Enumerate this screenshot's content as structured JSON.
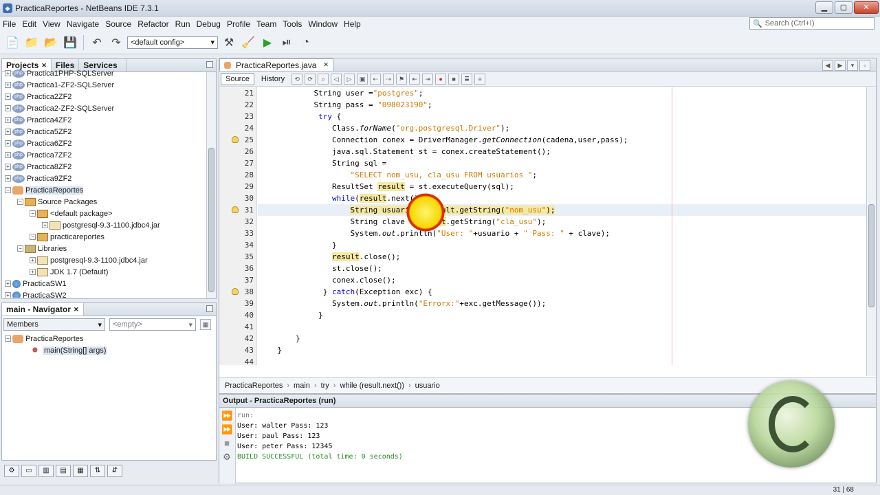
{
  "window": {
    "title": "PracticaReportes - NetBeans IDE 7.3.1"
  },
  "menu": [
    "File",
    "Edit",
    "View",
    "Navigate",
    "Source",
    "Refactor",
    "Run",
    "Debug",
    "Profile",
    "Team",
    "Tools",
    "Window",
    "Help"
  ],
  "search": {
    "placeholder": "Search (Ctrl+I)"
  },
  "toolbar": {
    "config": "<default config>"
  },
  "projects_panel": {
    "tabs": [
      "Projects",
      "Files",
      "Services"
    ],
    "items": [
      {
        "label": "Practica1PHP-SQLServer",
        "indent": 0,
        "icon": "php"
      },
      {
        "label": "Practica1-ZF2-SQLServer",
        "indent": 0,
        "icon": "php"
      },
      {
        "label": "Practica2ZF2",
        "indent": 0,
        "icon": "php"
      },
      {
        "label": "Practica2-ZF2-SQLServer",
        "indent": 0,
        "icon": "php"
      },
      {
        "label": "Practica4ZF2",
        "indent": 0,
        "icon": "php"
      },
      {
        "label": "Practica5ZF2",
        "indent": 0,
        "icon": "php"
      },
      {
        "label": "Practica6ZF2",
        "indent": 0,
        "icon": "php"
      },
      {
        "label": "Practica7ZF2",
        "indent": 0,
        "icon": "php"
      },
      {
        "label": "Practica8ZF2",
        "indent": 0,
        "icon": "php"
      },
      {
        "label": "Practica9ZF2",
        "indent": 0,
        "icon": "php"
      },
      {
        "label": "PracticaReportes",
        "indent": 0,
        "icon": "java",
        "selected": true
      },
      {
        "label": "Source Packages",
        "indent": 1,
        "icon": "pkg"
      },
      {
        "label": "<default package>",
        "indent": 2,
        "icon": "pkg"
      },
      {
        "label": "postgresql-9.3-1100.jdbc4.jar",
        "indent": 3,
        "icon": "jar"
      },
      {
        "label": "practicareportes",
        "indent": 2,
        "icon": "pkg"
      },
      {
        "label": "Libraries",
        "indent": 1,
        "icon": "lib"
      },
      {
        "label": "postgresql-9.3-1100.jdbc4.jar",
        "indent": 2,
        "icon": "jar"
      },
      {
        "label": "JDK 1.7 (Default)",
        "indent": 2,
        "icon": "jar"
      },
      {
        "label": "PracticaSW1",
        "indent": 0,
        "icon": "globe"
      },
      {
        "label": "PracticaSW2",
        "indent": 0,
        "icon": "globe"
      }
    ]
  },
  "navigator": {
    "title": "main - Navigator",
    "filter": "Members",
    "empty": "<empty>",
    "class": "PracticaReportes",
    "method": "main(String[] args)"
  },
  "editor": {
    "tab": "PracticaReportes.java",
    "source_label": "Source",
    "history_label": "History",
    "lines": [
      {
        "n": "21",
        "mark": false,
        "html": "            String user =<span class=\"str\">\"postgres\"</span>;"
      },
      {
        "n": "22",
        "mark": false,
        "html": "            String pass = <span class=\"str\">\"098023190\"</span>;"
      },
      {
        "n": "23",
        "mark": false,
        "html": "             <span class=\"kw\">try</span> {"
      },
      {
        "n": "24",
        "mark": false,
        "html": "                Class.<span class=\"it\">forName</span>(<span class=\"str\">\"org.postgresql.Driver\"</span>);"
      },
      {
        "n": "25",
        "mark": true,
        "html": "                Connection conex = DriverManager.<span class=\"it\">getConnection</span>(cadena,user,pass);"
      },
      {
        "n": "26",
        "mark": false,
        "html": "                java.sql.Statement st = conex.createStatement();"
      },
      {
        "n": "27",
        "mark": false,
        "html": "                String sql ="
      },
      {
        "n": "28",
        "mark": false,
        "html": "                    <span class=\"str\">\"SELECT nom_usu, cla_usu FROM usuarios \"</span>;"
      },
      {
        "n": "29",
        "mark": false,
        "html": "                ResultSet <span class=\"occ\">result</span> = st.executeQuery(sql);"
      },
      {
        "n": "30",
        "mark": false,
        "html": "                <span class=\"kw\">while</span>(<span class=\"occ\">result</span>.next()) {"
      },
      {
        "n": "31",
        "mark": true,
        "cur": true,
        "html": "                    <span class=\"occ\">String usuario = result.getString(<span class=\"str\">\"nom_usu\"</span>);</span>"
      },
      {
        "n": "32",
        "mark": false,
        "html": "                    String clave = <span class=\"occ\">result</span>.getString(<span class=\"str\">\"cla_usu\"</span>);"
      },
      {
        "n": "33",
        "mark": false,
        "html": "                    System.<span class=\"it\">out</span>.println(<span class=\"str\">\"User: \"</span>+usuario + <span class=\"str\">\" Pass: \"</span> + clave);"
      },
      {
        "n": "34",
        "mark": false,
        "html": "                }"
      },
      {
        "n": "35",
        "mark": false,
        "html": "                <span class=\"occ\">result</span>.close();"
      },
      {
        "n": "36",
        "mark": false,
        "html": "                st.close();"
      },
      {
        "n": "37",
        "mark": false,
        "html": "                conex.close();"
      },
      {
        "n": "38",
        "mark": true,
        "html": "              } <span class=\"kw\">catch</span>(Exception exc) {"
      },
      {
        "n": "39",
        "mark": false,
        "html": "                System.<span class=\"it\">out</span>.println(<span class=\"str\">\"Errorx:\"</span>+exc.getMessage());"
      },
      {
        "n": "40",
        "mark": false,
        "html": "             }"
      },
      {
        "n": "41",
        "mark": false,
        "html": ""
      },
      {
        "n": "42",
        "mark": false,
        "html": "        }"
      },
      {
        "n": "43",
        "mark": false,
        "html": "    }"
      },
      {
        "n": "44",
        "mark": false,
        "html": ""
      }
    ],
    "breadcrumbs": [
      "PracticaReportes",
      "main",
      "try",
      "while (result.next())",
      "usuario"
    ]
  },
  "output": {
    "title": "Output - PracticaReportes (run)",
    "lines": [
      {
        "text": "run:",
        "color": "#777777"
      },
      {
        "text": "User: walter Pass: 123",
        "color": "#000000"
      },
      {
        "text": "User: paul Pass: 123",
        "color": "#000000"
      },
      {
        "text": "User: peter Pass: 12345",
        "color": "#000000"
      },
      {
        "text": "BUILD SUCCESSFUL (total time: 0 seconds)",
        "color": "#2a8a2a"
      }
    ]
  },
  "status": {
    "position": "31 | 68"
  }
}
